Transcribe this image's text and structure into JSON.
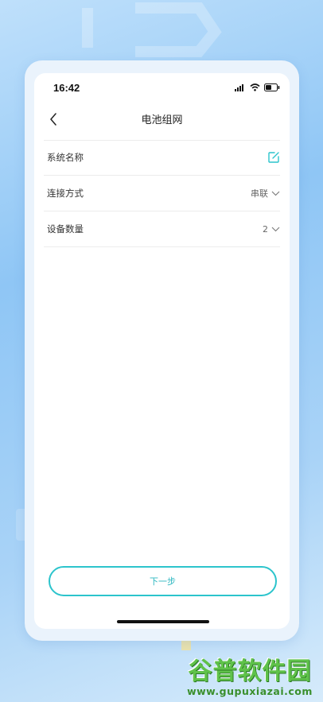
{
  "status_bar": {
    "time": "16:42"
  },
  "nav": {
    "title": "电池组网"
  },
  "form": {
    "rows": [
      {
        "label": "系统名称",
        "value": ""
      },
      {
        "label": "连接方式",
        "value": "串联"
      },
      {
        "label": "设备数量",
        "value": "2"
      }
    ]
  },
  "actions": {
    "next_label": "下一步"
  },
  "watermark": {
    "brand": "谷普软件园",
    "url": "www.gupuxiazai.com"
  },
  "colors": {
    "accent": "#2cc4cc",
    "background": "#a9d3f7",
    "watermark_green": "#5fc24a"
  }
}
